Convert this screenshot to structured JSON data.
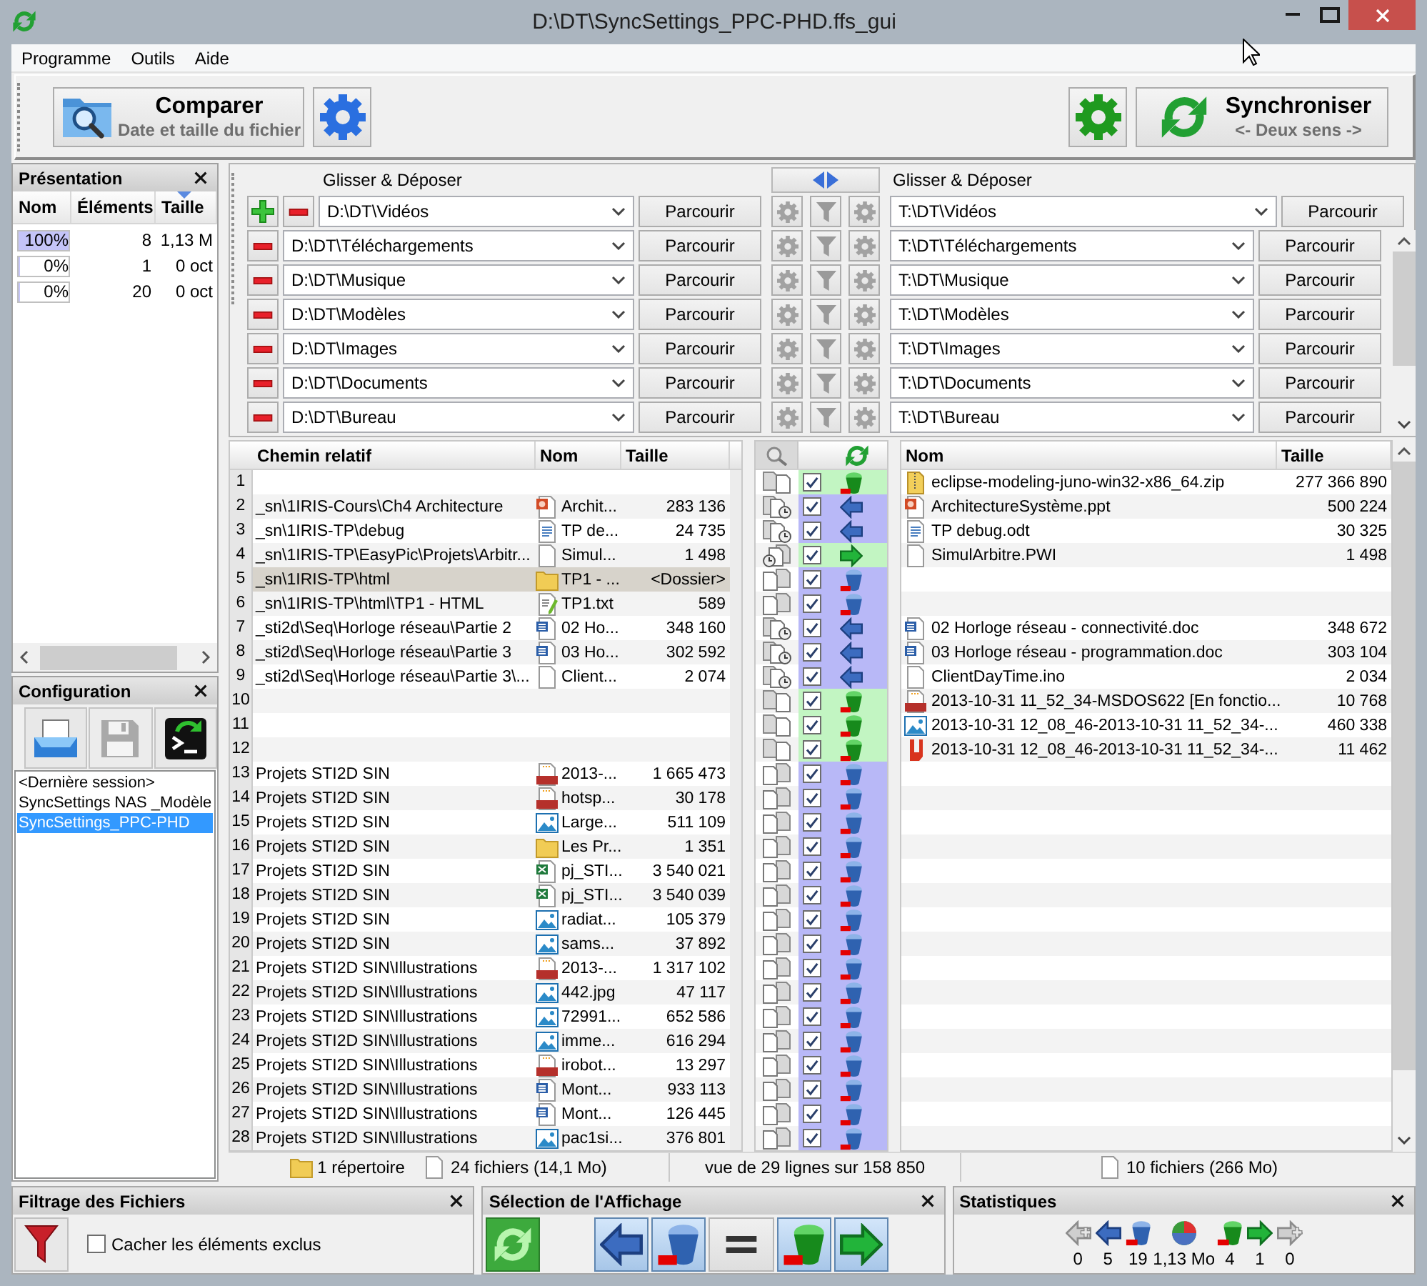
{
  "window": {
    "title": "D:\\DT\\SyncSettings_PPC-PHD.ffs_gui"
  },
  "menu": [
    {
      "label": "Programme"
    },
    {
      "label": "Outils"
    },
    {
      "label": "Aide"
    }
  ],
  "toolbar": {
    "compare": {
      "label": "Comparer",
      "sublabel": "Date et taille du fichier"
    },
    "synchronize": {
      "label": "Synchroniser",
      "sublabel": "<- Deux sens ->"
    }
  },
  "overview": {
    "title": "Présentation",
    "columns": [
      {
        "label": "Nom",
        "sorted": false
      },
      {
        "label": "Éléments",
        "sorted": false
      },
      {
        "label": "Taille",
        "sorted": true
      }
    ],
    "rows": [
      {
        "share": "100%",
        "level": 1,
        "count": "8",
        "size": "1,13 M"
      },
      {
        "share": "0%",
        "level": 0,
        "count": "1",
        "size": "0 oct"
      },
      {
        "share": "0%",
        "level": 0,
        "count": "20",
        "size": "0 oct"
      }
    ]
  },
  "configuration": {
    "title": "Configuration",
    "buttons": [
      {
        "kind": "load",
        "disabled": false
      },
      {
        "kind": "save",
        "disabled": true
      },
      {
        "kind": "batch",
        "disabled": false
      }
    ],
    "items": [
      {
        "label": "<Dernière session>",
        "selected": false
      },
      {
        "label": "SyncSettings NAS _Modèle",
        "selected": false
      },
      {
        "label": "SyncSettings_PPC-PHD",
        "selected": true
      }
    ]
  },
  "folder_pairs": {
    "left_label": "Glisser & Déposer",
    "right_label": "Glisser & Déposer",
    "pairs": [
      {
        "left": "D:\\DT\\Vidéos",
        "left_button": "Parcourir",
        "right": "T:\\DT\\Vidéos",
        "right_button": "Parcourir"
      },
      {
        "left": "D:\\DT\\Téléchargements",
        "left_button": "Parcourir",
        "right": "T:\\DT\\Téléchargements",
        "right_button": "Parcourir"
      },
      {
        "left": "D:\\DT\\Musique",
        "left_button": "Parcourir",
        "right": "T:\\DT\\Musique",
        "right_button": "Parcourir"
      },
      {
        "left": "D:\\DT\\Modèles",
        "left_button": "Parcourir",
        "right": "T:\\DT\\Modèles",
        "right_button": "Parcourir"
      },
      {
        "left": "D:\\DT\\Images",
        "left_button": "Parcourir",
        "right": "T:\\DT\\Images",
        "right_button": "Parcourir"
      },
      {
        "left": "D:\\DT\\Documents",
        "left_button": "Parcourir",
        "right": "T:\\DT\\Documents",
        "right_button": "Parcourir"
      },
      {
        "left": "D:\\DT\\Bureau",
        "left_button": "Parcourir",
        "right": "T:\\DT\\Bureau",
        "right_button": "Parcourir"
      }
    ]
  },
  "grid": {
    "left_columns": [
      "Chemin relatif",
      "Nom",
      "Taille"
    ],
    "right_columns": [
      "Nom",
      "Taille"
    ],
    "rows": [
      {
        "number": "1",
        "selected": false,
        "category": {
          "kind": "right_only"
        },
        "checked": true,
        "action": {
          "kind": "delete_right"
        },
        "right": {
          "kind": "zip",
          "name": "eclipse-modeling-juno-win32-x86_64.zip",
          "size": "277 366 890"
        }
      },
      {
        "number": "2",
        "selected": false,
        "left": {
          "path": "_sn\\1IRIS-Cours\\Ch4 Architecture",
          "kind": "ppt",
          "name": "Archit...",
          "size": "283 136"
        },
        "category": {
          "kind": "right_newer"
        },
        "checked": true,
        "action": {
          "kind": "copy_left"
        },
        "right": {
          "kind": "ppt",
          "name": "ArchitectureSystème.ppt",
          "size": "500 224"
        }
      },
      {
        "number": "3",
        "selected": false,
        "left": {
          "path": "_sn\\1IRIS-TP\\debug",
          "kind": "odt",
          "name": "TP de...",
          "size": "24 735"
        },
        "category": {
          "kind": "right_newer"
        },
        "checked": true,
        "action": {
          "kind": "copy_left"
        },
        "right": {
          "kind": "odt",
          "name": "TP debug.odt",
          "size": "30 325"
        }
      },
      {
        "number": "4",
        "selected": false,
        "left": {
          "path": "_sn\\1IRIS-TP\\EasyPic\\Projets\\Arbitr...",
          "kind": "file",
          "name": "Simul...",
          "size": "1 498"
        },
        "category": {
          "kind": "left_newer"
        },
        "checked": true,
        "action": {
          "kind": "copy_right"
        },
        "right": {
          "kind": "file",
          "name": "SimulArbitre.PWI",
          "size": "1 498"
        }
      },
      {
        "number": "5",
        "selected": true,
        "left": {
          "path": "_sn\\1IRIS-TP\\html",
          "kind": "folder",
          "name": "TP1 - ...",
          "size": "<Dossier>"
        },
        "category": {
          "kind": "left_only"
        },
        "checked": true,
        "action": {
          "kind": "delete_left"
        }
      },
      {
        "number": "6",
        "selected": false,
        "left": {
          "path": "_sn\\1IRIS-TP\\html\\TP1 - HTML",
          "kind": "txt",
          "name": "TP1.txt",
          "size": "589"
        },
        "category": {
          "kind": "left_only"
        },
        "checked": true,
        "action": {
          "kind": "delete_left"
        }
      },
      {
        "number": "7",
        "selected": false,
        "left": {
          "path": "_sti2d\\Seq\\Horloge réseau\\Partie 2",
          "kind": "word",
          "name": "02 Ho...",
          "size": "348 160"
        },
        "category": {
          "kind": "right_newer"
        },
        "checked": true,
        "action": {
          "kind": "copy_left"
        },
        "right": {
          "kind": "word",
          "name": "02 Horloge réseau - connectivité.doc",
          "size": "348 672"
        }
      },
      {
        "number": "8",
        "selected": false,
        "left": {
          "path": "_sti2d\\Seq\\Horloge réseau\\Partie 3",
          "kind": "word",
          "name": "03 Ho...",
          "size": "302 592"
        },
        "category": {
          "kind": "right_newer"
        },
        "checked": true,
        "action": {
          "kind": "copy_left"
        },
        "right": {
          "kind": "word",
          "name": "03 Horloge réseau - programmation.doc",
          "size": "303 104"
        }
      },
      {
        "number": "9",
        "selected": false,
        "left": {
          "path": "_sti2d\\Seq\\Horloge réseau\\Partie 3\\...",
          "kind": "file",
          "name": "Client...",
          "size": "2 074"
        },
        "category": {
          "kind": "right_newer"
        },
        "checked": true,
        "action": {
          "kind": "copy_left"
        },
        "right": {
          "kind": "file",
          "name": "ClientDayTime.ino",
          "size": "2 034"
        }
      },
      {
        "number": "10",
        "selected": false,
        "category": {
          "kind": "right_only"
        },
        "checked": true,
        "action": {
          "kind": "delete_right"
        },
        "right": {
          "kind": "png",
          "name": "2013-10-31 11_52_34-MSDOS622 [En fonctio...",
          "size": "10 768"
        }
      },
      {
        "number": "11",
        "selected": false,
        "category": {
          "kind": "right_only"
        },
        "checked": true,
        "action": {
          "kind": "delete_right"
        },
        "right": {
          "kind": "image",
          "name": "2013-10-31 12_08_46-2013-10-31 11_52_34-...",
          "size": "460 338"
        }
      },
      {
        "number": "12",
        "selected": false,
        "category": {
          "kind": "right_only"
        },
        "checked": true,
        "action": {
          "kind": "delete_right"
        },
        "right": {
          "kind": "pdf",
          "name": "2013-10-31 12_08_46-2013-10-31 11_52_34-...",
          "size": "11 462"
        }
      },
      {
        "number": "13",
        "selected": false,
        "left": {
          "path": "Projets STI2D SIN",
          "kind": "png",
          "name": "2013-...",
          "size": "1 665 473"
        },
        "category": {
          "kind": "left_only"
        },
        "checked": true,
        "action": {
          "kind": "delete_left"
        }
      },
      {
        "number": "14",
        "selected": false,
        "left": {
          "path": "Projets STI2D SIN",
          "kind": "png",
          "name": "hotsp...",
          "size": "30 178"
        },
        "category": {
          "kind": "left_only"
        },
        "checked": true,
        "action": {
          "kind": "delete_left"
        }
      },
      {
        "number": "15",
        "selected": false,
        "left": {
          "path": "Projets STI2D SIN",
          "kind": "image",
          "name": "Large...",
          "size": "511 109"
        },
        "category": {
          "kind": "left_only"
        },
        "checked": true,
        "action": {
          "kind": "delete_left"
        }
      },
      {
        "number": "16",
        "selected": false,
        "left": {
          "path": "Projets STI2D SIN",
          "kind": "folder",
          "name": "Les Pr...",
          "size": "1 351"
        },
        "category": {
          "kind": "left_only"
        },
        "checked": true,
        "action": {
          "kind": "delete_left"
        }
      },
      {
        "number": "17",
        "selected": false,
        "left": {
          "path": "Projets STI2D SIN",
          "kind": "excel",
          "name": "pj_STI...",
          "size": "3 540 021"
        },
        "category": {
          "kind": "left_only"
        },
        "checked": true,
        "action": {
          "kind": "delete_left"
        }
      },
      {
        "number": "18",
        "selected": false,
        "left": {
          "path": "Projets STI2D SIN",
          "kind": "excel",
          "name": "pj_STI...",
          "size": "3 540 039"
        },
        "category": {
          "kind": "left_only"
        },
        "checked": true,
        "action": {
          "kind": "delete_left"
        }
      },
      {
        "number": "19",
        "selected": false,
        "left": {
          "path": "Projets STI2D SIN",
          "kind": "image",
          "name": "radiat...",
          "size": "105 379"
        },
        "category": {
          "kind": "left_only"
        },
        "checked": true,
        "action": {
          "kind": "delete_left"
        }
      },
      {
        "number": "20",
        "selected": false,
        "left": {
          "path": "Projets STI2D SIN",
          "kind": "image",
          "name": "sams...",
          "size": "37 892"
        },
        "category": {
          "kind": "left_only"
        },
        "checked": true,
        "action": {
          "kind": "delete_left"
        }
      },
      {
        "number": "21",
        "selected": false,
        "left": {
          "path": "Projets STI2D SIN\\Illustrations",
          "kind": "png",
          "name": "2013-...",
          "size": "1 317 102"
        },
        "category": {
          "kind": "left_only"
        },
        "checked": true,
        "action": {
          "kind": "delete_left"
        }
      },
      {
        "number": "22",
        "selected": false,
        "left": {
          "path": "Projets STI2D SIN\\Illustrations",
          "kind": "image",
          "name": "442.jpg",
          "size": "47 117"
        },
        "category": {
          "kind": "left_only"
        },
        "checked": true,
        "action": {
          "kind": "delete_left"
        }
      },
      {
        "number": "23",
        "selected": false,
        "left": {
          "path": "Projets STI2D SIN\\Illustrations",
          "kind": "image",
          "name": "72991...",
          "size": "652 586"
        },
        "category": {
          "kind": "left_only"
        },
        "checked": true,
        "action": {
          "kind": "delete_left"
        }
      },
      {
        "number": "24",
        "selected": false,
        "left": {
          "path": "Projets STI2D SIN\\Illustrations",
          "kind": "image",
          "name": "imme...",
          "size": "616 294"
        },
        "category": {
          "kind": "left_only"
        },
        "checked": true,
        "action": {
          "kind": "delete_left"
        }
      },
      {
        "number": "25",
        "selected": false,
        "left": {
          "path": "Projets STI2D SIN\\Illustrations",
          "kind": "png",
          "name": "irobot...",
          "size": "13 297"
        },
        "category": {
          "kind": "left_only"
        },
        "checked": true,
        "action": {
          "kind": "delete_left"
        }
      },
      {
        "number": "26",
        "selected": false,
        "left": {
          "path": "Projets STI2D SIN\\Illustrations",
          "kind": "word",
          "name": "Mont...",
          "size": "933 113"
        },
        "category": {
          "kind": "left_only"
        },
        "checked": true,
        "action": {
          "kind": "delete_left"
        }
      },
      {
        "number": "27",
        "selected": false,
        "left": {
          "path": "Projets STI2D SIN\\Illustrations",
          "kind": "word",
          "name": "Mont...",
          "size": "126 445"
        },
        "category": {
          "kind": "left_only"
        },
        "checked": true,
        "action": {
          "kind": "delete_left"
        }
      },
      {
        "number": "28",
        "selected": false,
        "left": {
          "path": "Projets STI2D SIN\\Illustrations",
          "kind": "image",
          "name": "pac1si...",
          "size": "376 801"
        },
        "category": {
          "kind": "left_only"
        },
        "checked": true,
        "action": {
          "kind": "delete_left"
        }
      }
    ]
  },
  "status_bar": {
    "left_folders": "1 répertoire",
    "left_files": "24 fichiers (14,1 Mo)",
    "rows_shown": "vue de 29 lignes sur 158 850",
    "right_files": "10 fichiers (266 Mo)"
  },
  "filter_panel": {
    "title": "Filtrage des Fichiers",
    "hide_excluded": {
      "label": "Cacher les éléments exclus",
      "checked": false
    }
  },
  "view_panel": {
    "title": "Sélection de l'Affichage",
    "buttons": [
      {
        "kind": "sync_view",
        "selected": true
      },
      {
        "kind": "copy_left",
        "selected": true
      },
      {
        "kind": "delete_left",
        "selected": true
      },
      {
        "kind": "equal",
        "selected": false
      },
      {
        "kind": "delete_right",
        "selected": true
      },
      {
        "kind": "copy_right",
        "selected": true
      }
    ]
  },
  "statistics": {
    "title": "Statistiques",
    "items": [
      {
        "kind": "create_left",
        "value": "0"
      },
      {
        "kind": "copy_left",
        "value": "5"
      },
      {
        "kind": "delete_left",
        "value": "19"
      },
      {
        "kind": "data",
        "value": "1,13 Mo"
      },
      {
        "kind": "delete_right",
        "value": "4"
      },
      {
        "kind": "copy_right",
        "value": "1"
      },
      {
        "kind": "create_right",
        "value": "0"
      }
    ]
  }
}
